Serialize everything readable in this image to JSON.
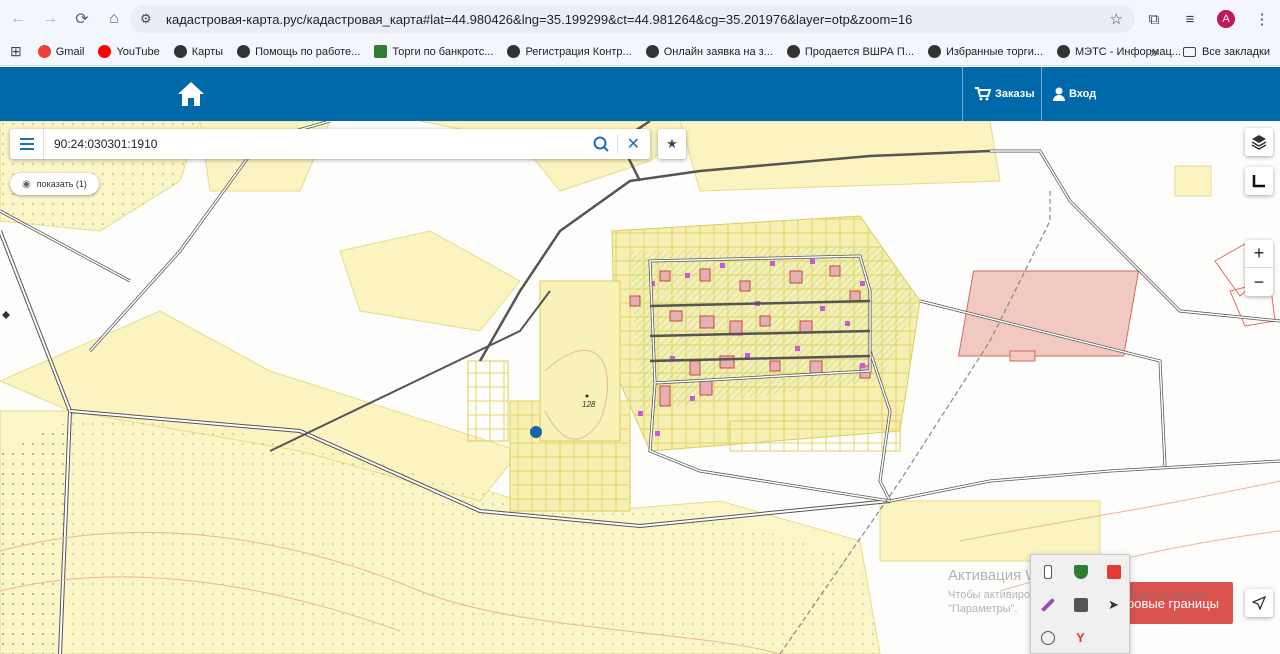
{
  "browser": {
    "url": "кадастровая-карта.рус/кадастровая_карта#lat=44.980426&lng=35.199299&ct=44.981264&cg=35.201976&layer=otp&zoom=16",
    "avatar_letter": "A"
  },
  "bookmarks": {
    "items": [
      {
        "label": "Gmail"
      },
      {
        "label": "YouTube"
      },
      {
        "label": "Карты"
      },
      {
        "label": "Помощь по работе..."
      },
      {
        "label": "Торги по банкротс..."
      },
      {
        "label": "Регистрация Контр..."
      },
      {
        "label": "Онлайн заявка на з..."
      },
      {
        "label": "Продается ВШРА П..."
      },
      {
        "label": "Избранные торги..."
      },
      {
        "label": "МЭТС - Информац..."
      }
    ],
    "more": "»",
    "all_label": "Все закладки"
  },
  "header": {
    "orders_label": "Заказы",
    "login_label": "Вход",
    "color": "#0069aa"
  },
  "search": {
    "value": "90:24:030301:1910"
  },
  "map": {
    "show_button": "показать (1)",
    "elevation_label": "128",
    "red_button": "тровые границы",
    "zoom_in": "+",
    "zoom_out": "−"
  },
  "watermark": {
    "title": "Активация Windows",
    "line1": "Чтобы активировать Windows, перейдите в раздел",
    "line2": "\"Параметры\"."
  }
}
